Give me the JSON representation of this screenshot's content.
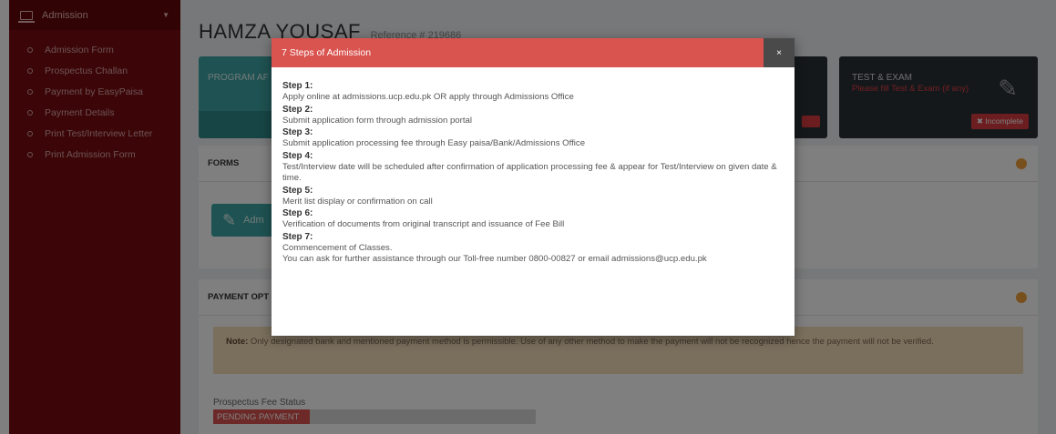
{
  "sidebar": {
    "header_label": "Admission",
    "items": [
      {
        "label": "Admission Form"
      },
      {
        "label": "Prospectus Challan"
      },
      {
        "label": "Payment by EasyPaisa"
      },
      {
        "label": "Payment Details"
      },
      {
        "label": "Print Test/Interview Letter"
      },
      {
        "label": "Print Admission Form"
      }
    ]
  },
  "header": {
    "name": "HAMZA YOUSAF",
    "reference": "Reference # 219686"
  },
  "cards": {
    "program_label": "PROGRAM AF",
    "test_title": "TEST & EXAM",
    "test_subtitle": "Please fill Test & Exam (if any)",
    "incomplete_label": "Incomplete"
  },
  "forms_panel": {
    "title": "FORMS",
    "button_label": "Adm"
  },
  "payment_panel": {
    "title": "PAYMENT OPT",
    "note_label": "Note:",
    "note_text": " Only designated bank and mentioned payment method is permissible. Use of any other method to make the payment will not be recognized hence the payment will not be verified.",
    "fee_status_label": "Prospectus Fee Status",
    "fee_status_value": "PENDING PAYMENT"
  },
  "modal": {
    "title": "7 Steps of Admission",
    "close_label": "×",
    "steps": [
      {
        "title": "Step 1:",
        "text": "Apply online at admissions.ucp.edu.pk OR apply through Admissions Office"
      },
      {
        "title": "Step 2:",
        "text": "Submit application form through admission portal"
      },
      {
        "title": "Step 3:",
        "text": "Submit application processing fee through Easy paisa/Bank/Admissions Office"
      },
      {
        "title": "Step 4:",
        "text": "Test/Interview date will be scheduled after confirmation of application processing fee & appear for Test/Interview on given date & time."
      },
      {
        "title": "Step 5:",
        "text": "Merit list display or confirmation on call"
      },
      {
        "title": "Step 6:",
        "text": "Verification of documents from original transcript and issuance of Fee Bill"
      },
      {
        "title": "Step 7:",
        "text": "Commencement of Classes."
      }
    ],
    "footer_text": "You can ask for further assistance through our Toll-free number 0800-00827 or email admissions@ucp.edu.pk"
  },
  "colors": {
    "sidebar": "#780b0e",
    "modal_header": "#d9534f",
    "teal": "#3ea5a5",
    "warning": "#f0a13a"
  }
}
